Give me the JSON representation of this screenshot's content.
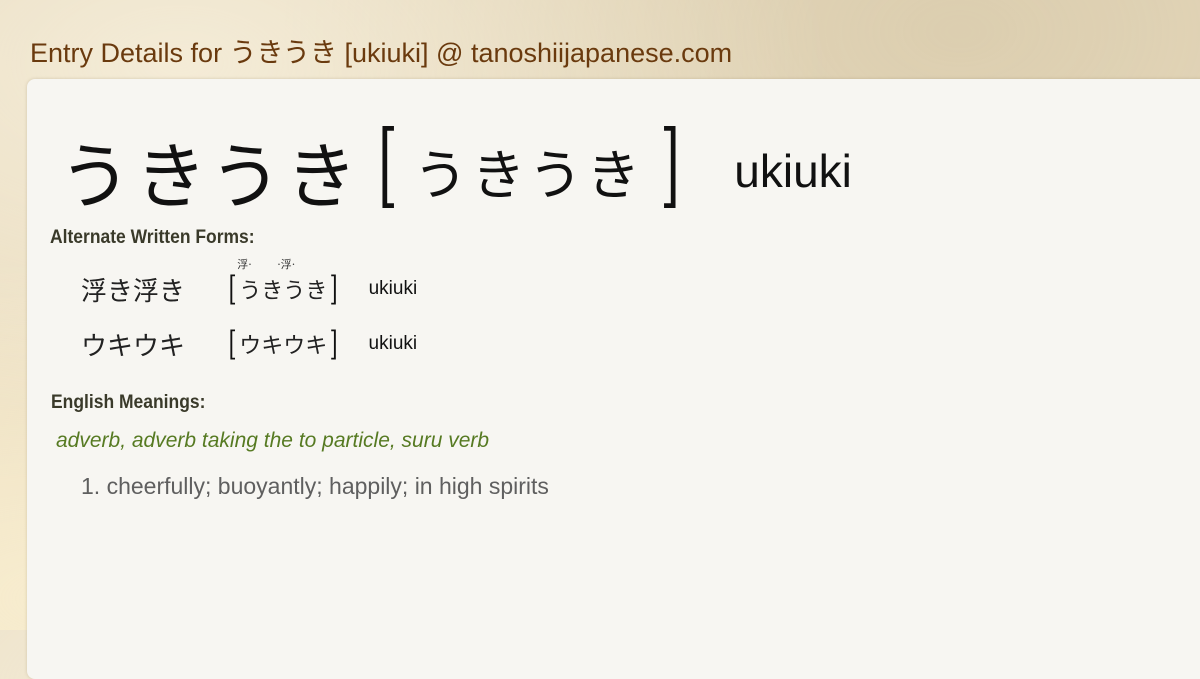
{
  "header": {
    "title": "Entry Details for うきうき [ukiuki] @ tanoshiijapanese.com"
  },
  "entry": {
    "word": "うきうき",
    "reading": "うきうき",
    "romaji": "ukiuki"
  },
  "alternate_forms": {
    "label": "Alternate Written Forms:",
    "items": [
      {
        "written": "浮き浮き",
        "reading_chars": [
          "う",
          "き",
          "う",
          "き"
        ],
        "furigana": [
          "浮·",
          "",
          "·浮·",
          ""
        ],
        "romaji": "ukiuki"
      },
      {
        "written": "ウキウキ",
        "reading": "ウキウキ",
        "romaji": "ukiuki"
      }
    ]
  },
  "meanings": {
    "label": "English Meanings:",
    "part_of_speech": "adverb, adverb taking the to particle, suru verb",
    "definitions": [
      "1. cheerfully; buoyantly; happily; in high spirits"
    ]
  },
  "brackets": {
    "open": "[",
    "close": "]"
  },
  "colors": {
    "title": "#6a3a0e",
    "pos": "#567a22",
    "meaning": "#5f5f5f",
    "panel": "#f7f6f2"
  }
}
